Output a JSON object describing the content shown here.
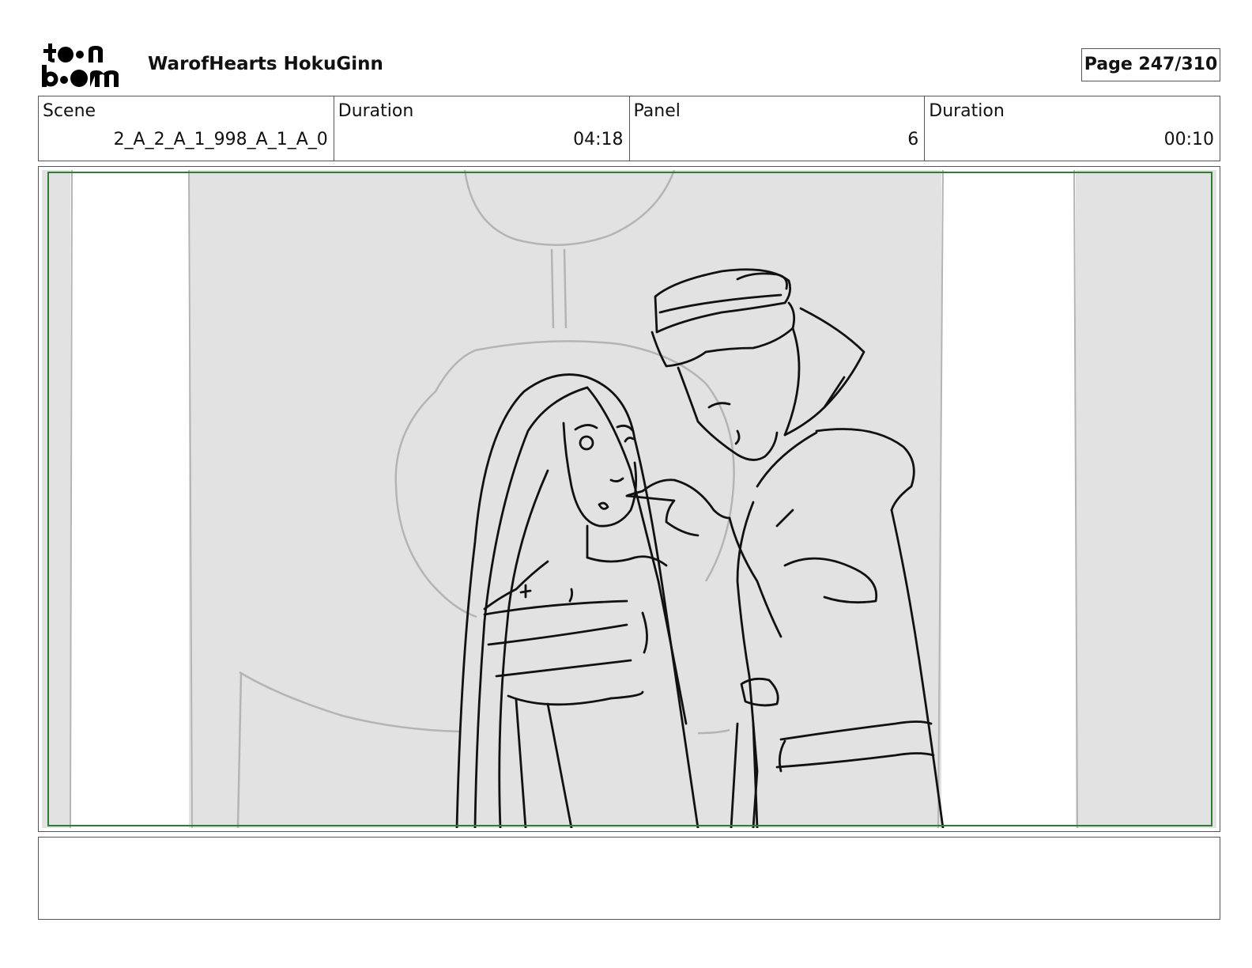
{
  "header": {
    "logo_text": "toon boom",
    "project_title": "WarofHearts HokuGinn",
    "page_label": "Page 247/310"
  },
  "info": {
    "scene_label": "Scene",
    "scene_value": "2_A_2_A_1_998_A_1_A_0",
    "scene_duration_label": "Duration",
    "scene_duration_value": "04:18",
    "panel_label": "Panel",
    "panel_value": "6",
    "panel_duration_label": "Duration",
    "panel_duration_value": "00:10"
  },
  "panel": {
    "safe_area_color": "#2e7d32",
    "background_color": "#e2e2e2",
    "sketch_line_color": "#111111",
    "background_sketch_color": "#b4b4b4"
  },
  "notes": {
    "text": ""
  }
}
